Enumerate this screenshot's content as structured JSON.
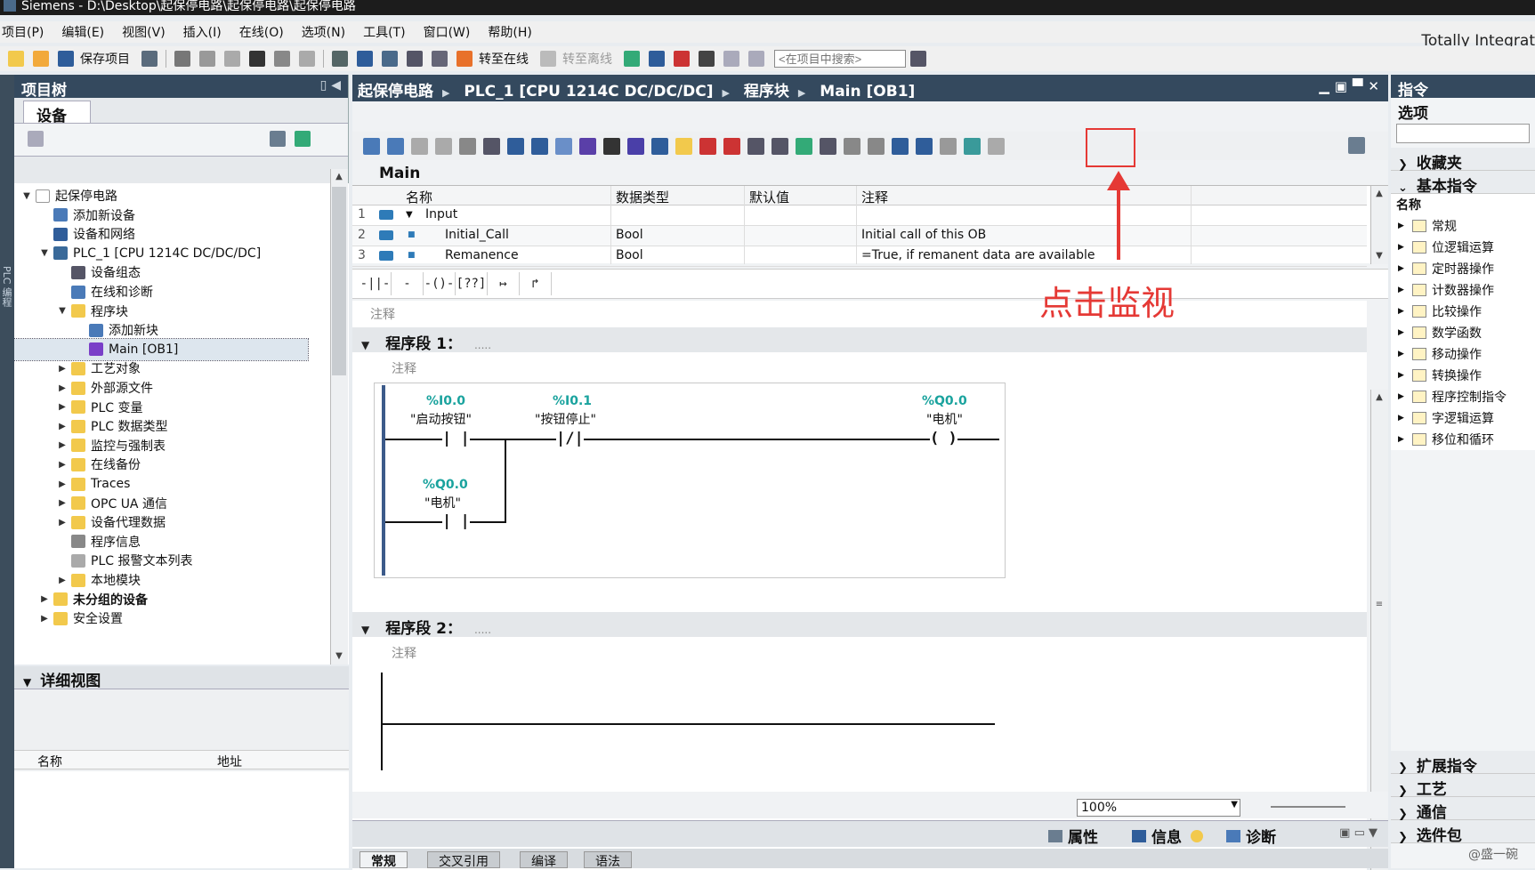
{
  "window": {
    "title": "Siemens  -  D:\\Desktop\\起保停电路\\起保停电路\\起保停电路",
    "brand": "Totally Integrat"
  },
  "menu": [
    "项目(P)",
    "编辑(E)",
    "视图(V)",
    "插入(I)",
    "在线(O)",
    "选项(N)",
    "工具(T)",
    "窗口(W)",
    "帮助(H)"
  ],
  "toolbar": {
    "save_label": "保存项目",
    "go_online": "转至在线",
    "go_offline": "转至离线",
    "search_placeholder": "<在项目中搜索>"
  },
  "left_strip_label": "PLC 编程",
  "project_tree": {
    "title": "项目树",
    "tab": "设备",
    "items": [
      {
        "label": "起保停电路",
        "level": 0,
        "expanded": true,
        "icon": "project-icon"
      },
      {
        "label": "添加新设备",
        "level": 1,
        "icon": "add-device-icon"
      },
      {
        "label": "设备和网络",
        "level": 1,
        "icon": "network-icon"
      },
      {
        "label": "PLC_1 [CPU 1214C DC/DC/DC]",
        "level": 1,
        "expanded": true,
        "icon": "plc-icon"
      },
      {
        "label": "设备组态",
        "level": 2,
        "icon": "device-config-icon"
      },
      {
        "label": "在线和诊断",
        "level": 2,
        "icon": "diagnostics-icon"
      },
      {
        "label": "程序块",
        "level": 2,
        "expanded": true,
        "icon": "folder-icon"
      },
      {
        "label": "添加新块",
        "level": 3,
        "icon": "add-block-icon"
      },
      {
        "label": "Main [OB1]",
        "level": 3,
        "icon": "ob-icon",
        "selected": true
      },
      {
        "label": "工艺对象",
        "level": 2,
        "collapsed": true,
        "icon": "folder-icon"
      },
      {
        "label": "外部源文件",
        "level": 2,
        "collapsed": true,
        "icon": "folder-icon"
      },
      {
        "label": "PLC 变量",
        "level": 2,
        "collapsed": true,
        "icon": "folder-icon"
      },
      {
        "label": "PLC 数据类型",
        "level": 2,
        "collapsed": true,
        "icon": "folder-icon"
      },
      {
        "label": "监控与强制表",
        "level": 2,
        "collapsed": true,
        "icon": "folder-icon"
      },
      {
        "label": "在线备份",
        "level": 2,
        "collapsed": true,
        "icon": "folder-icon"
      },
      {
        "label": "Traces",
        "level": 2,
        "collapsed": true,
        "icon": "folder-icon"
      },
      {
        "label": "OPC UA 通信",
        "level": 2,
        "collapsed": true,
        "icon": "folder-icon"
      },
      {
        "label": "设备代理数据",
        "level": 2,
        "collapsed": true,
        "icon": "folder-icon"
      },
      {
        "label": "程序信息",
        "level": 2,
        "icon": "info-icon"
      },
      {
        "label": "PLC 报警文本列表",
        "level": 2,
        "icon": "list-icon"
      },
      {
        "label": "本地模块",
        "level": 2,
        "collapsed": true,
        "icon": "folder-icon"
      },
      {
        "label": "未分组的设备",
        "level": 1,
        "collapsed": true,
        "icon": "folder-icon",
        "bold": true
      },
      {
        "label": "安全设置",
        "level": 1,
        "collapsed": true,
        "icon": "folder-icon"
      }
    ]
  },
  "detail_view": {
    "title": "详细视图",
    "col_name": "名称",
    "col_address": "地址"
  },
  "editor": {
    "breadcrumb": [
      "起保停电路",
      "PLC_1 [CPU 1214C DC/DC/DC]",
      "程序块",
      "Main [OB1]"
    ],
    "block_name": "Main",
    "interface": {
      "headers": [
        "名称",
        "数据类型",
        "默认值",
        "注释"
      ],
      "rows": [
        {
          "num": "1",
          "name": "Input",
          "type": "",
          "default": "",
          "comment": ""
        },
        {
          "num": "2",
          "name": "Initial_Call",
          "type": "Bool",
          "default": "",
          "comment": "Initial call of this OB"
        },
        {
          "num": "3",
          "name": "Remanence",
          "type": "Bool",
          "default": "",
          "comment": "=True, if remanent data are available"
        }
      ]
    },
    "block_comment": "注释",
    "networks": [
      {
        "title": "程序段 1：",
        "dots": ".....",
        "comment": "注释",
        "contacts": [
          {
            "addr": "%I0.0",
            "tag": "\"启动按钮\"",
            "symbol": "-| |-"
          },
          {
            "addr": "%I0.1",
            "tag": "\"按钮停止\"",
            "symbol": "-|/|-"
          },
          {
            "addr": "%Q0.0",
            "tag": "\"电机\"",
            "symbol": "-( )-"
          },
          {
            "addr": "%Q0.0",
            "tag": "\"电机\"",
            "symbol": "-| |-"
          }
        ]
      },
      {
        "title": "程序段 2：",
        "dots": ".....",
        "comment": "注释"
      }
    ],
    "zoom": "100%",
    "inspector_tabs": [
      "属性",
      "信息",
      "诊断"
    ],
    "property_tabs": [
      "常规",
      "交叉引用",
      "编译",
      "语法"
    ]
  },
  "annotation": {
    "text": "点击监视",
    "color": "#e53935"
  },
  "right_panel": {
    "title": "指令",
    "options": "选项",
    "favorites": "收藏夹",
    "basic": "基本指令",
    "name_col": "名称",
    "items": [
      "常规",
      "位逻辑运算",
      "定时器操作",
      "计数器操作",
      "比较操作",
      "数学函数",
      "移动操作",
      "转换操作",
      "程序控制指令",
      "字逻辑运算",
      "移位和循环"
    ],
    "sections": [
      "扩展指令",
      "工艺",
      "通信",
      "选件包"
    ]
  },
  "watermark": "@盛一碗",
  "colors": {
    "header": "#34495e",
    "address": "#1aa39e",
    "highlight": "#e53935"
  }
}
